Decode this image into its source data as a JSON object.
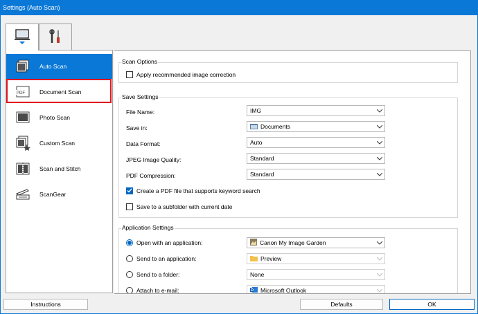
{
  "window": {
    "title": "Settings (Auto Scan)"
  },
  "tabs": [
    {
      "name": "scan-from-computer",
      "icon": "computer-scan-icon"
    },
    {
      "name": "general-settings",
      "icon": "tools-icon"
    }
  ],
  "sidebar": {
    "items": [
      {
        "label": "Auto Scan",
        "icon": "auto-scan-icon",
        "selected": true
      },
      {
        "label": "Document Scan",
        "icon": "pdf-document-icon",
        "selected": false,
        "highlighted": true
      },
      {
        "label": "Photo Scan",
        "icon": "photo-icon",
        "selected": false
      },
      {
        "label": "Custom Scan",
        "icon": "custom-scan-icon",
        "selected": false
      },
      {
        "label": "Scan and Stitch",
        "icon": "stitch-icon",
        "selected": false
      },
      {
        "label": "ScanGear",
        "icon": "scanner-icon",
        "selected": false
      }
    ]
  },
  "scan_options": {
    "title": "Scan Options",
    "recommended_correction": {
      "label": "Apply recommended image correction",
      "checked": false
    }
  },
  "save_settings": {
    "title": "Save Settings",
    "file_name": {
      "label": "File Name:",
      "value": "IMG"
    },
    "save_in": {
      "label": "Save in:",
      "value": "Documents"
    },
    "data_format": {
      "label": "Data Format:",
      "value": "Auto"
    },
    "jpeg_quality": {
      "label": "JPEG Image Quality:",
      "value": "Standard"
    },
    "pdf_compression": {
      "label": "PDF Compression:",
      "value": "Standard"
    },
    "keyword_pdf": {
      "label": "Create a PDF file that supports keyword search",
      "checked": true
    },
    "subfolder": {
      "label": "Save to a subfolder with current date",
      "checked": false
    }
  },
  "application_settings": {
    "title": "Application Settings",
    "options": [
      {
        "label": "Open with an application:",
        "value": "Canon My Image Garden",
        "checked": true,
        "enabled": true
      },
      {
        "label": "Send to an application:",
        "value": "Preview",
        "checked": false,
        "enabled": false
      },
      {
        "label": "Send to a folder:",
        "value": "None",
        "checked": false,
        "enabled": false
      },
      {
        "label": "Attach to e-mail:",
        "value": "Microsoft Outlook",
        "checked": false,
        "enabled": false
      }
    ]
  },
  "buttons": {
    "instructions": "Instructions",
    "defaults": "Defaults",
    "ok": "OK"
  },
  "colors": {
    "title_bar": "#0a78d7",
    "selected": "#0a78d7",
    "highlight": "#e0161c",
    "check": "#0067c0"
  }
}
